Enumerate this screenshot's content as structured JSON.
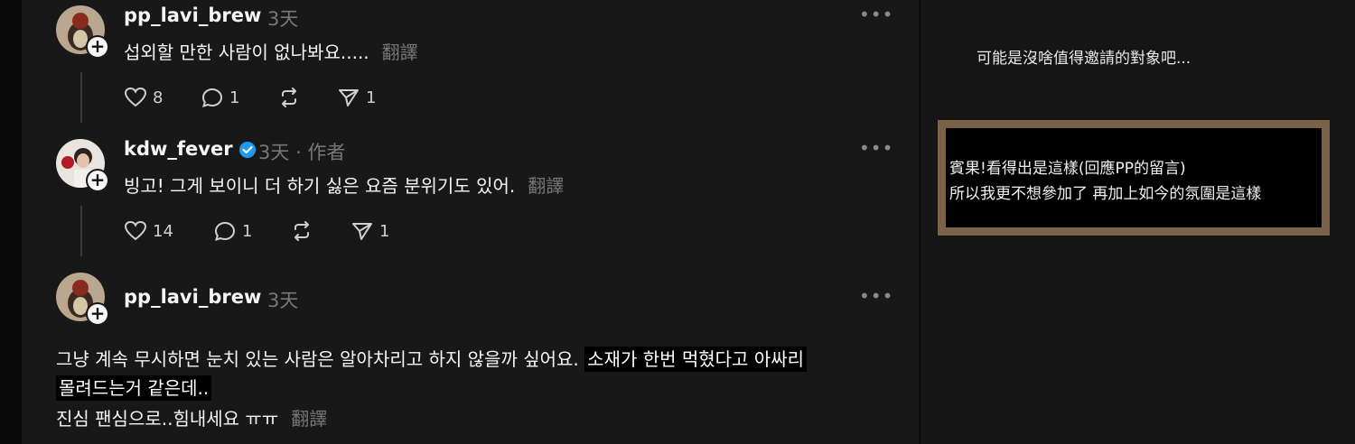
{
  "posts": [
    {
      "username": "pp_lavi_brew",
      "time": "3天",
      "text": "섭외할 만한 사람이 없나봐요.....",
      "translate": "翻譯",
      "likes": "8",
      "replies": "1",
      "shares": "1"
    },
    {
      "username": "kdw_fever",
      "time": "3天",
      "author_tag": "· 作者",
      "text": "빙고! 그게 보이니 더 하기 싫은 요즘 분위기도 있어.",
      "translate": "翻譯",
      "likes": "14",
      "replies": "1",
      "shares": "1"
    },
    {
      "username": "pp_lavi_brew",
      "time": "3天",
      "text_line1_a": "그냥 계속 무시하면 눈치 있는 사람은 알아차리고 하지 않을까 싶어요.",
      "text_line1_b": "소재가 한번 먹혔다고 아싸리",
      "text_line2": "몰려드는거 같은데..",
      "text_line3": "진심 팬심으로..힘내세요 ㅠㅠ",
      "translate": "翻譯"
    }
  ],
  "annotations": {
    "note1": "可能是沒啥值得邀請的對象吧...",
    "box_line1": "賓果!看得出是這樣(回應PP的留言)",
    "box_line2": "所以我更不想參加了 再加上如今的氛圍是這樣"
  },
  "icons": {
    "like": "heart-icon",
    "reply": "comment-icon",
    "repost": "repost-icon",
    "share": "send-icon",
    "more": "more-icon",
    "verified": "verified-badge-icon"
  }
}
